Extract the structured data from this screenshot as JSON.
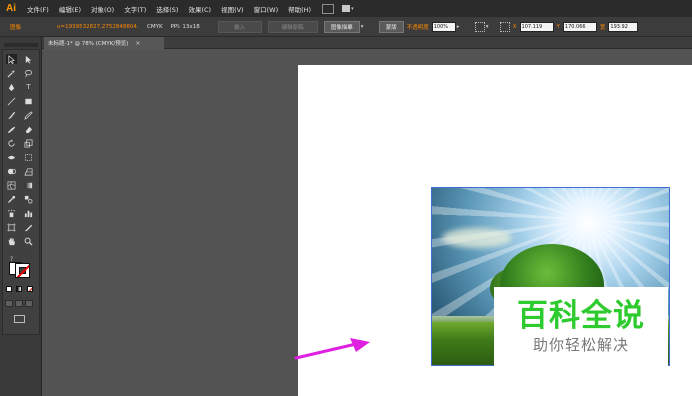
{
  "menubar": {
    "logo": "Ai",
    "items": [
      "文件(F)",
      "编辑(E)",
      "对象(O)",
      "文字(T)",
      "选择(S)",
      "效果(C)",
      "视图(V)",
      "窗口(W)",
      "帮助(H)"
    ]
  },
  "controlbar": {
    "mode_label": "图像",
    "file_name": "u=1939532827,2752848804...",
    "color_mode": "CMYK",
    "ppi": "PPI: 13x18",
    "embed_button": "嵌入",
    "edit_original_button": "编辑原稿",
    "image_trace_button": "图像描摹",
    "mask_button": "蒙版",
    "opacity_label": "不透明度",
    "opacity_value": "100%",
    "x_label": "X",
    "x_value": "107.119",
    "y_label": "Y",
    "y_value": "170.066",
    "w_label": "宽",
    "w_value": "193.92"
  },
  "document": {
    "tab_title": "未标题-1* @ 78% (CMYK/预览)",
    "tab_close": "×"
  },
  "toolbar": {
    "help_glyph": "?",
    "text_tool_glyph": "T"
  },
  "watermark": {
    "title": "百科全说",
    "subtitle": "助你轻松解决"
  },
  "colors": {
    "accent_orange": "#ff8a00",
    "arrow_magenta": "#e020e0",
    "watermark_green": "#2ecb2e",
    "selection_blue": "#3f6fd6"
  }
}
